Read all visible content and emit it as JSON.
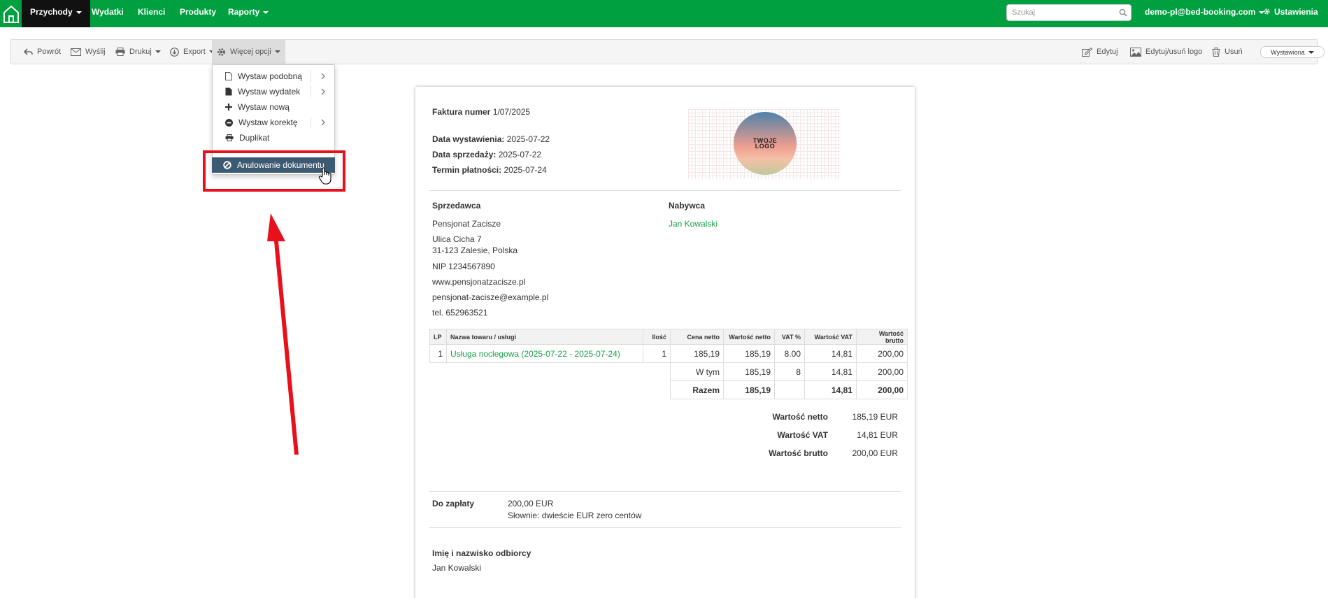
{
  "nav": {
    "items": [
      "Przychody",
      "Wydatki",
      "Klienci",
      "Produkty",
      "Raporty"
    ],
    "search_placeholder": "Szukaj",
    "user": "demo-pl@bed-booking.com",
    "settings": "Ustawienia",
    "brand_color": "#00a040"
  },
  "toolbar": {
    "back": "Powrót",
    "send": "Wyślij",
    "print": "Drukuj",
    "export": "Export",
    "more": "Więcej opcji",
    "edit": "Edytuj",
    "edit_logo": "Edytuj/usuń logo",
    "delete": "Usuń",
    "status": "Wystawiona"
  },
  "menu": {
    "items": [
      "Wystaw podobną",
      "Wystaw wydatek",
      "Wystaw nową",
      "Wystaw korektę",
      "Duplikat"
    ],
    "cancel": "Anulowanie dokumentu"
  },
  "invoice": {
    "number_label": "Faktura numer",
    "number": "1/07/2025",
    "issue_label": "Data wystawienia:",
    "issue_date": "2025-07-22",
    "sale_label": "Data sprzedaży:",
    "sale_date": "2025-07-22",
    "due_label": "Termin płatności:",
    "due_date": "2025-07-24",
    "logo_line1": "TWOJE",
    "logo_line2": "LOGO",
    "seller_label": "Sprzedawca",
    "seller_name": "Pensjonat Zacisze",
    "seller_street": "Ulica Cicha 7",
    "seller_city": "31-123 Zalesie, Polska",
    "seller_nip": "NIP 1234567890",
    "seller_www": "www.pensjonatzacisze.pl",
    "seller_email": "pensjonat-zacisze@example.pl",
    "seller_tel": "tel. 652963521",
    "buyer_label": "Nabywca",
    "buyer_name": "Jan Kowalski",
    "headers": [
      "LP",
      "Nazwa towaru / usługi",
      "Ilość",
      "Cena netto",
      "Wartość netto",
      "VAT %",
      "Wartość VAT",
      "Wartość brutto"
    ],
    "row": {
      "lp": "1",
      "name": "Usługa noclegowa (2025-07-22 - 2025-07-24)",
      "qty": "1",
      "price": "185,19",
      "net": "185,19",
      "vat_pct": "8.00",
      "vat": "14,81",
      "gross": "200,00"
    },
    "wtym": {
      "label": "W tym",
      "net": "185,19",
      "vat_pct": "8",
      "vat": "14,81",
      "gross": "200,00"
    },
    "razem": {
      "label": "Razem",
      "net": "185,19",
      "vat": "14,81",
      "gross": "200,00"
    },
    "net_total_label": "Wartość netto",
    "net_total": "185,19 EUR",
    "vat_total_label": "Wartość VAT",
    "vat_total": "14,81 EUR",
    "gross_total_label": "Wartość brutto",
    "gross_total": "200,00 EUR",
    "to_pay_label": "Do zapłaty",
    "to_pay": "200,00 EUR",
    "in_words": "Słownie: dwieście EUR zero centów",
    "recipient_label": "Imię i nazwisko odbiorcy",
    "recipient": "Jan Kowalski"
  }
}
